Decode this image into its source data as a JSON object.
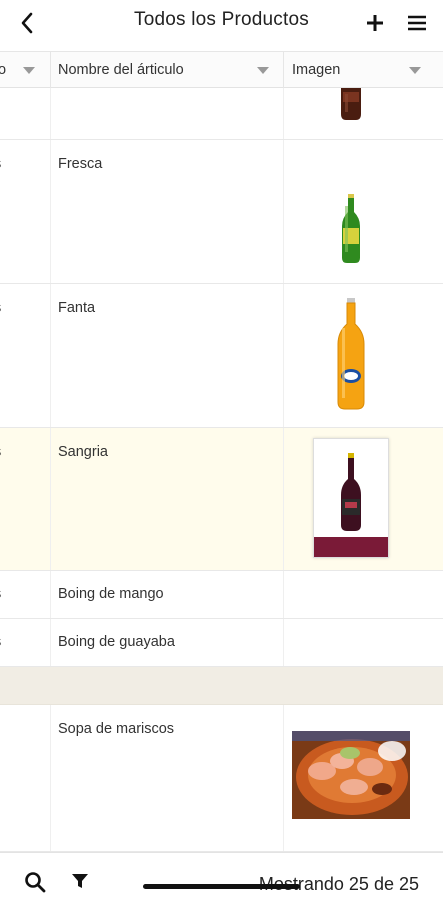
{
  "header": {
    "title": "Todos los Productos"
  },
  "columns": {
    "col0_label": "o",
    "name_label": "Nombre del árticulo",
    "image_label": "Imagen"
  },
  "rows": [
    {
      "c0": "",
      "name": "",
      "image": "coca-cola-bottle"
    },
    {
      "c0": "s",
      "name": "Fresca",
      "image": "fresca-bottle"
    },
    {
      "c0": "s",
      "name": "Fanta",
      "image": "fanta-bottle"
    },
    {
      "c0": "s",
      "name": "Sangria",
      "image": "sangria-bottle",
      "selected": true
    },
    {
      "c0": "s",
      "name": "Boing de mango",
      "image": ""
    },
    {
      "c0": "s",
      "name": "Boing de guayaba",
      "image": ""
    },
    {
      "c0": "",
      "name": "",
      "image": "",
      "group": true
    },
    {
      "c0": "",
      "name": "Sopa de mariscos",
      "image": "seafood-soup-photo"
    }
  ],
  "footer": {
    "count_text": "Mostrando 25 de 25"
  },
  "colors": {
    "selected_row": "#fffcec",
    "group_row": "#f1ede4",
    "sangria_label": "#7a1a37"
  }
}
